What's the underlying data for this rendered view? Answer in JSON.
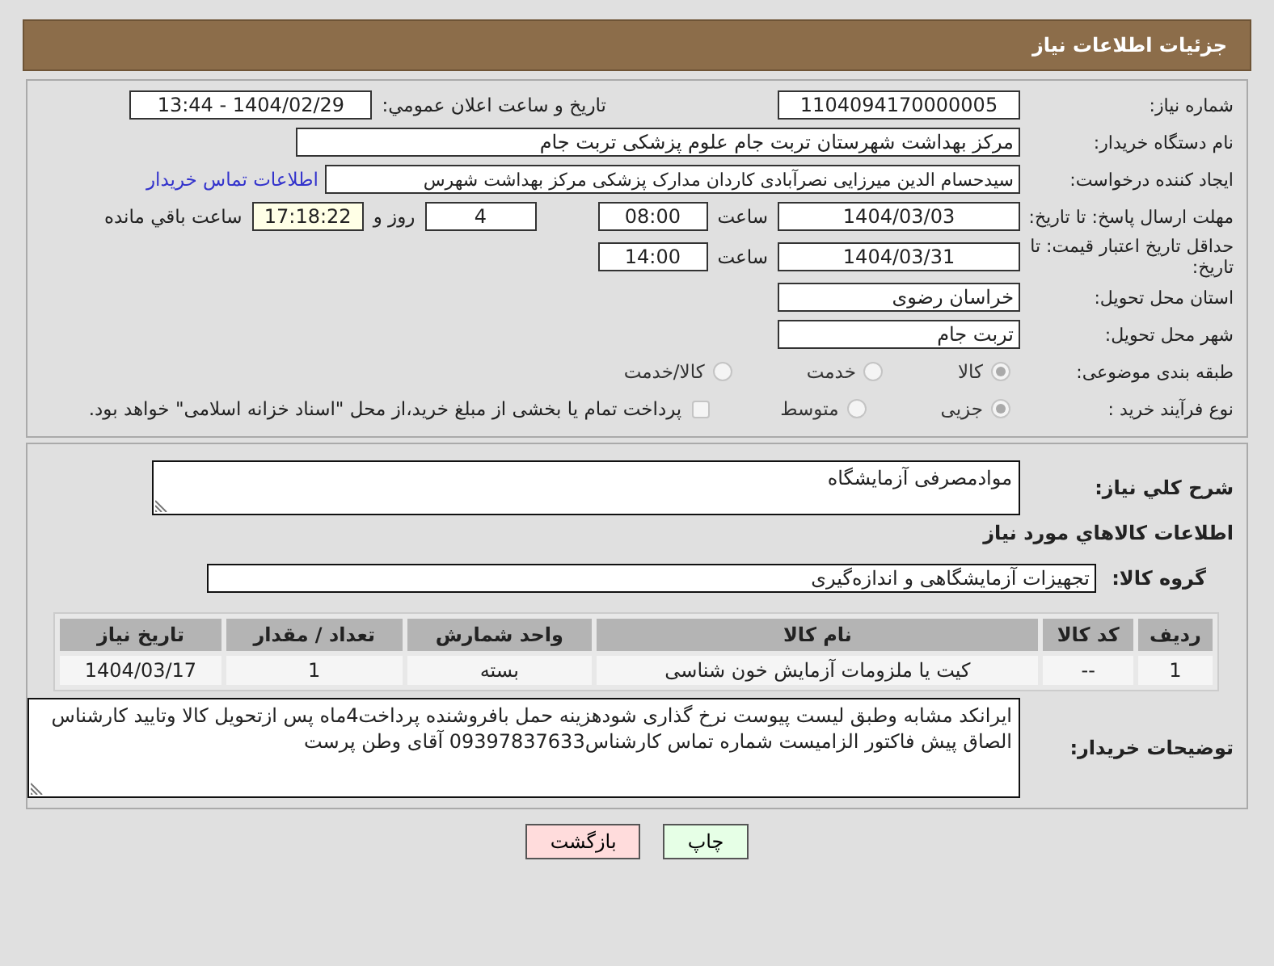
{
  "header": {
    "title": "جزئیات اطلاعات نیاز"
  },
  "need_number": {
    "label": "شماره نیاز:",
    "value": "1104094170000005"
  },
  "announce": {
    "label": "تاریخ و ساعت اعلان عمومي:",
    "value": "1404/02/29 - 13:44"
  },
  "buyer_org": {
    "label": "نام دستگاه خریدار:",
    "value": "مرکز بهداشت شهرستان تربت جام  علوم پزشکی تربت جام"
  },
  "requester": {
    "label": "ایجاد کننده درخواست:",
    "value": "سیدحسام الدین میرزایی نصرآبادی کاردان مدارک پزشکی مرکز بهداشت شهرس",
    "link": "اطلاعات تماس خریدار"
  },
  "deadline": {
    "label": "مهلت ارسال پاسخ: تا تاریخ:",
    "date": "1404/03/03",
    "time_label": "ساعت",
    "time": "08:00",
    "days": "4",
    "days_label": "روز و",
    "remaining": "17:18:22",
    "remaining_label": "ساعت باقي مانده"
  },
  "validity": {
    "label": "حداقل تاریخ اعتبار قیمت: تا تاریخ:",
    "date": "1404/03/31",
    "time_label": "ساعت",
    "time": "14:00"
  },
  "province": {
    "label": "استان محل تحویل:",
    "value": "خراسان رضوی"
  },
  "city": {
    "label": "شهر محل تحویل:",
    "value": "تربت جام"
  },
  "category": {
    "label": "طبقه بندی موضوعی:",
    "options": [
      {
        "label": "کالا",
        "selected": true
      },
      {
        "label": "خدمت",
        "selected": false
      },
      {
        "label": "کالا/خدمت",
        "selected": false
      }
    ]
  },
  "process": {
    "label": "نوع فرآیند خرید :",
    "options": [
      {
        "label": "جزیی",
        "selected": true
      },
      {
        "label": "متوسط",
        "selected": false
      }
    ],
    "payment": {
      "label": "پرداخت تمام یا بخشی از مبلغ خرید،از محل \"اسناد خزانه اسلامی\" خواهد بود.",
      "checked": false
    }
  },
  "description": {
    "label": "شرح کلي نیاز:",
    "value": "موادمصرفی آزمایشگاه"
  },
  "goods_heading": "اطلاعات کالاهاي مورد نیاز",
  "goods_group": {
    "label": "گروه کالا:",
    "value": "تجهیزات آزمایشگاهی و اندازه‌گیری"
  },
  "table": {
    "columns": [
      "ردیف",
      "کد کالا",
      "نام کالا",
      "واحد شمارش",
      "تعداد / مقدار",
      "تاریخ نیاز"
    ],
    "rows": [
      [
        "1",
        "--",
        "کیت یا ملزومات آزمایش خون شناسی",
        "بسته",
        "1",
        "1404/03/17"
      ]
    ]
  },
  "buyer_notes": {
    "label": "توضیحات خریدار:",
    "value": "ایرانکد مشابه وطبق لیست پیوست نرخ گذاری شودهزینه حمل بافروشنده پرداخت4ماه پس ازتحویل کالا وتایید کارشناس الصاق پیش فاکتور الزامیست شماره تماس کارشناس09397837633 آقای وطن پرست"
  },
  "buttons": [
    {
      "label": "چاپ",
      "kind": "print"
    },
    {
      "label": "بازگشت",
      "kind": "back"
    }
  ]
}
